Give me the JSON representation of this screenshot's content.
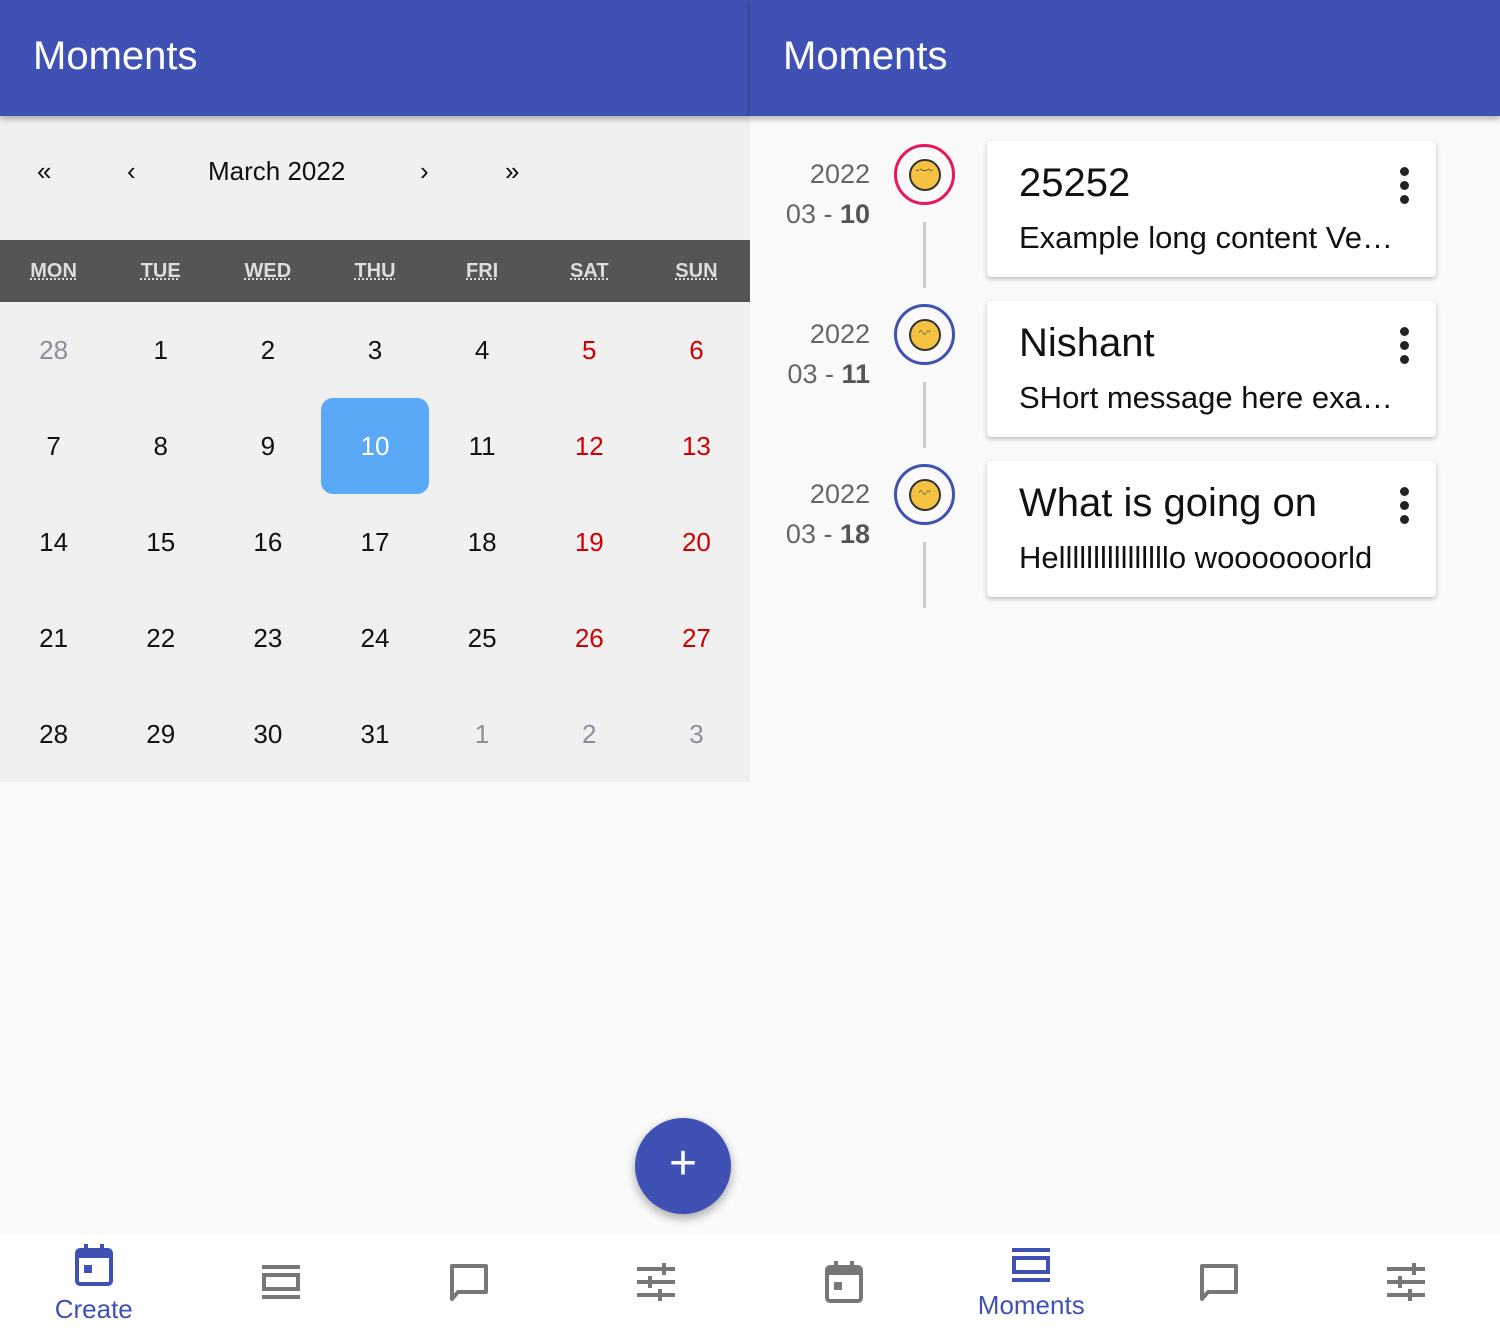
{
  "left": {
    "title": "Moments",
    "calendar": {
      "month_label": "March 2022",
      "prev_year": "«",
      "prev_month": "‹",
      "next_month": "›",
      "next_year": "»",
      "weekdays": [
        "MON",
        "TUE",
        "WED",
        "THU",
        "FRI",
        "SAT",
        "SUN"
      ],
      "days": [
        {
          "d": "28",
          "other": true
        },
        {
          "d": "1"
        },
        {
          "d": "2"
        },
        {
          "d": "3"
        },
        {
          "d": "4"
        },
        {
          "d": "5"
        },
        {
          "d": "6"
        },
        {
          "d": "7"
        },
        {
          "d": "8"
        },
        {
          "d": "9"
        },
        {
          "d": "10",
          "selected": true
        },
        {
          "d": "11"
        },
        {
          "d": "12"
        },
        {
          "d": "13"
        },
        {
          "d": "14"
        },
        {
          "d": "15"
        },
        {
          "d": "16"
        },
        {
          "d": "17"
        },
        {
          "d": "18"
        },
        {
          "d": "19"
        },
        {
          "d": "20"
        },
        {
          "d": "21"
        },
        {
          "d": "22"
        },
        {
          "d": "23"
        },
        {
          "d": "24"
        },
        {
          "d": "25"
        },
        {
          "d": "26"
        },
        {
          "d": "27"
        },
        {
          "d": "28"
        },
        {
          "d": "29"
        },
        {
          "d": "30"
        },
        {
          "d": "31"
        },
        {
          "d": "1",
          "other": true
        },
        {
          "d": "2",
          "other": true
        },
        {
          "d": "3",
          "other": true
        }
      ]
    },
    "fab": "+",
    "nav": [
      {
        "icon": "calendar-icon",
        "label": "Create",
        "active": true
      },
      {
        "icon": "view-list-icon",
        "label": ""
      },
      {
        "icon": "chat-icon",
        "label": ""
      },
      {
        "icon": "tune-icon",
        "label": ""
      }
    ]
  },
  "right": {
    "title": "Moments",
    "entries": [
      {
        "year": "2022",
        "month": "03 - ",
        "day": "10",
        "mood": "pensive",
        "ring": "#e8175d",
        "title": "25252",
        "body": "Example long content Very long content here"
      },
      {
        "year": "2022",
        "month": "03 - ",
        "day": "11",
        "mood": "grin",
        "ring": "#3f51b5",
        "title": "Nishant",
        "body": "SHort message here example"
      },
      {
        "year": "2022",
        "month": "03 - ",
        "day": "18",
        "mood": "grin",
        "ring": "#3f51b5",
        "title": "What is going on",
        "body": "Hellllllllllllllllo wooooooorld"
      }
    ],
    "nav": [
      {
        "icon": "calendar-icon",
        "label": ""
      },
      {
        "icon": "view-list-icon",
        "label": "Moments",
        "active": true
      },
      {
        "icon": "chat-icon",
        "label": ""
      },
      {
        "icon": "tune-icon",
        "label": ""
      }
    ]
  },
  "colors": {
    "primary": "#3f51b5",
    "selected": "#5aa9f7",
    "weekend": "#d10000"
  }
}
